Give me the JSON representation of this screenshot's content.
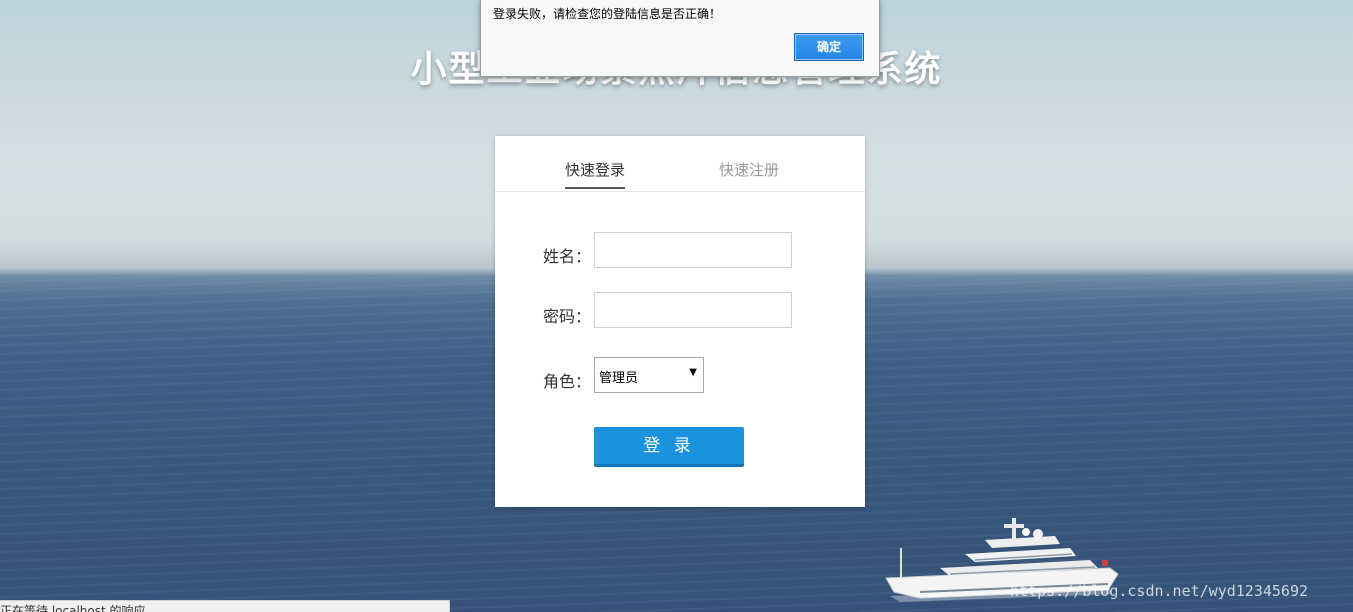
{
  "page": {
    "title": "小型工业场景照片信息管理系统"
  },
  "alert": {
    "message": "登录失败，请检查您的登陆信息是否正确！",
    "ok_label": "确定"
  },
  "login_card": {
    "tabs": [
      {
        "label": "快速登录",
        "active": true
      },
      {
        "label": "快速注册",
        "active": false
      }
    ],
    "name_label": "姓名：",
    "name_value": "",
    "password_label": "密码：",
    "password_value": "",
    "role_label": "角色：",
    "role_selected": "管理员",
    "submit_label": "登 录"
  },
  "status_bar": {
    "text": "正在等待 localhost 的响应..."
  },
  "watermark": {
    "text": "https://blog.csdn.net/wyd12345692"
  },
  "colors": {
    "primary_button": "#1b92dd",
    "alert_ok": "#2a8ae8"
  }
}
